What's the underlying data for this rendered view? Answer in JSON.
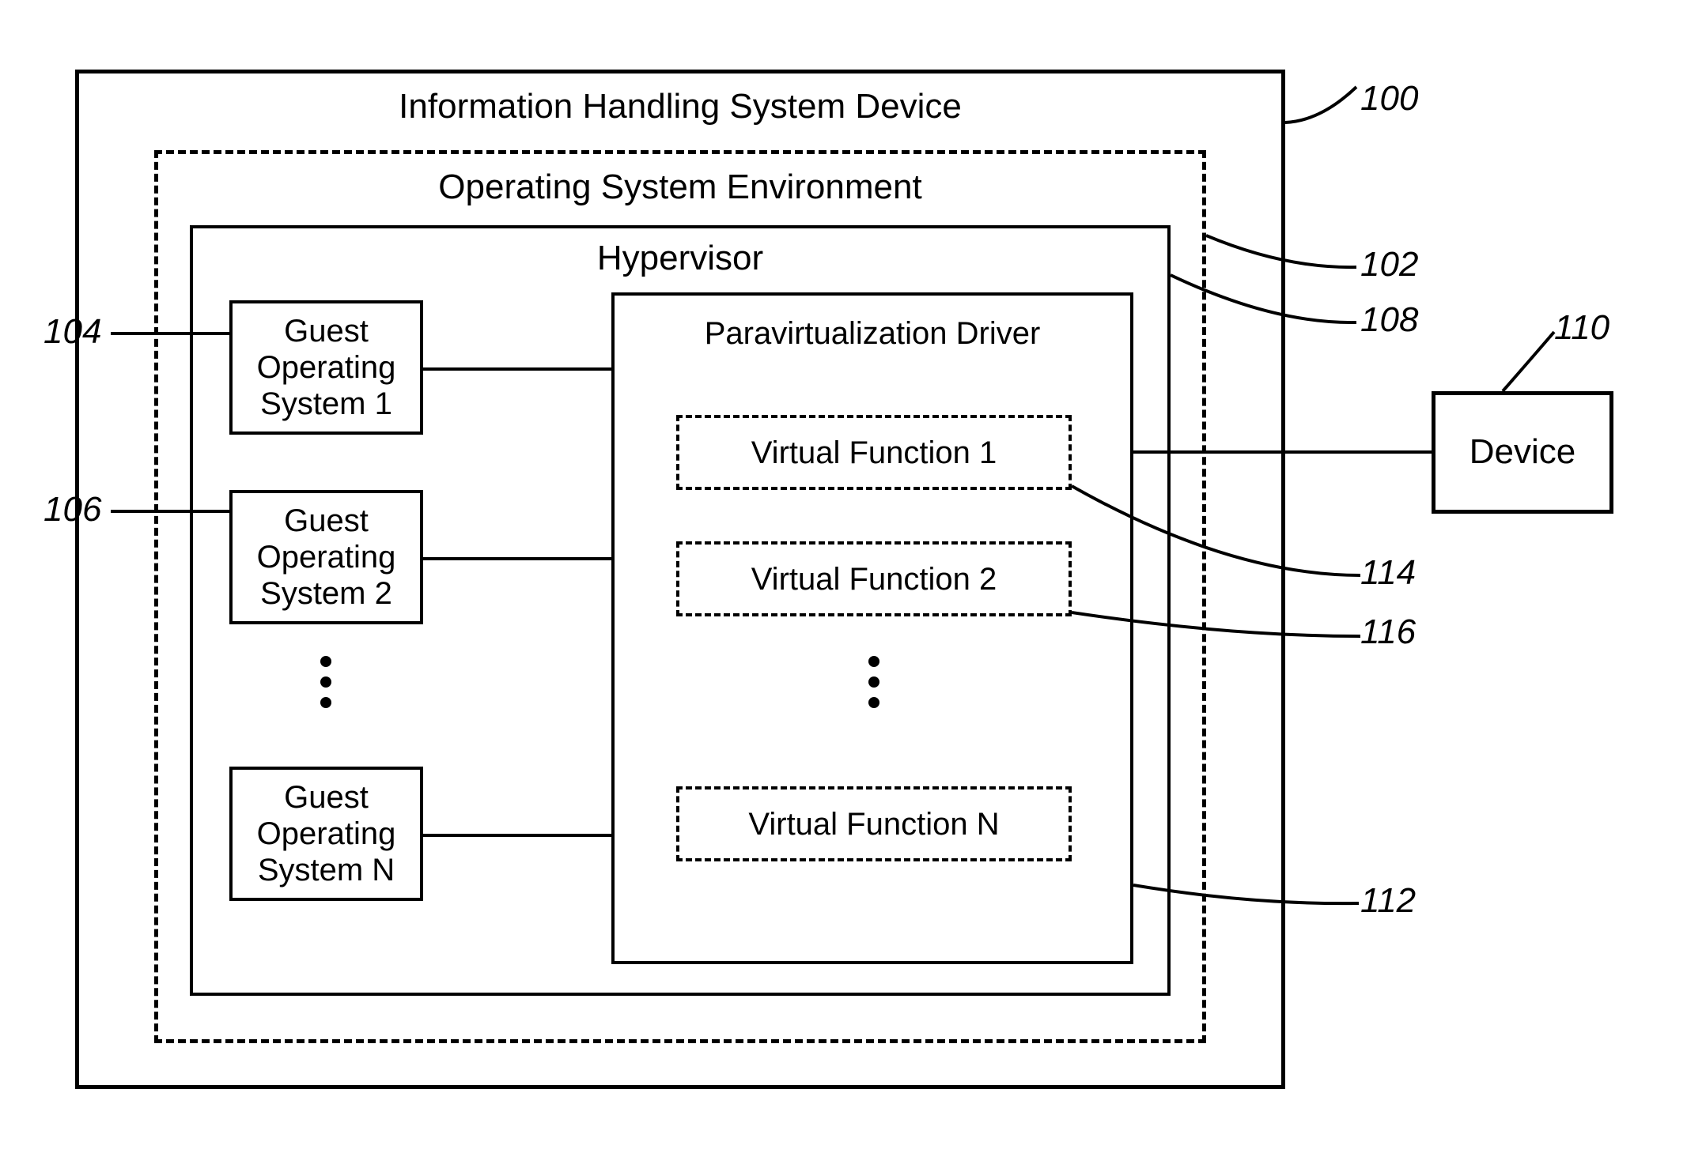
{
  "outer": {
    "title": "Information Handling System Device"
  },
  "os_env": {
    "title": "Operating System Environment"
  },
  "hypervisor": {
    "title": "Hypervisor"
  },
  "driver": {
    "title": "Paravirtualization Driver"
  },
  "guests": [
    {
      "l1": "Guest",
      "l2": "Operating",
      "l3": "System 1"
    },
    {
      "l1": "Guest",
      "l2": "Operating",
      "l3": "System 2"
    },
    {
      "l1": "Guest",
      "l2": "Operating",
      "l3": "System N"
    }
  ],
  "vfs": [
    {
      "label": "Virtual Function 1"
    },
    {
      "label": "Virtual Function 2"
    },
    {
      "label": "Virtual Function N"
    }
  ],
  "device": {
    "label": "Device"
  },
  "refs": {
    "r100": "100",
    "r102": "102",
    "r104": "104",
    "r106": "106",
    "r108": "108",
    "r110": "110",
    "r112": "112",
    "r114": "114",
    "r116": "116"
  }
}
